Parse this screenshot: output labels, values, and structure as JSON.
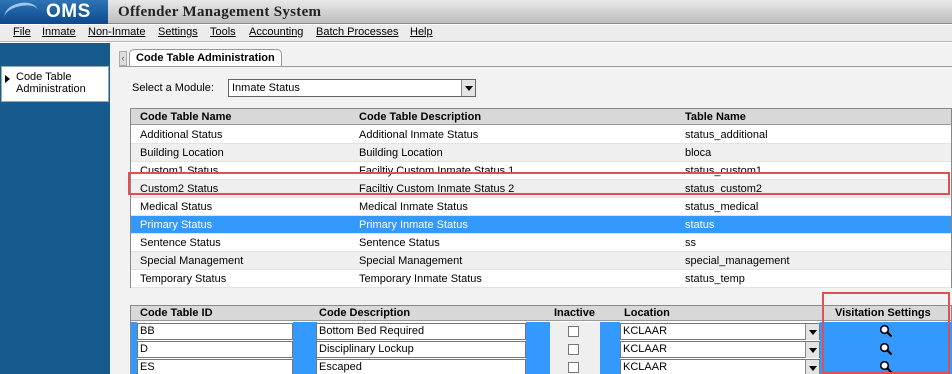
{
  "app": {
    "logo": "OMS",
    "title": "Offender Management System"
  },
  "menu": [
    "File",
    "Inmate",
    "Non-Inmate",
    "Settings",
    "Tools",
    "Accounting",
    "Batch Processes",
    "Help"
  ],
  "sidebar": {
    "items": [
      {
        "label": "Code Table Administration",
        "arrow_icon": "triangle-right-icon"
      }
    ]
  },
  "tab": {
    "label": "Code Table Administration"
  },
  "module": {
    "label": "Select a Module:",
    "value": "Inmate Status"
  },
  "code_tables": {
    "headers": [
      "Code Table Name",
      "Code Table Description",
      "Table Name"
    ],
    "rows": [
      [
        "Additional Status",
        "Additional Inmate Status",
        "status_additional"
      ],
      [
        "Building Location",
        "Building Location",
        "bloca"
      ],
      [
        "Custom1 Status",
        "Faciltiy Custom Inmate Status 1",
        "status_custom1"
      ],
      [
        "Custom2 Status",
        "Faciltiy Custom Inmate Status 2",
        "status_custom2"
      ],
      [
        "Medical Status",
        "Medical Inmate Status",
        "status_medical"
      ],
      [
        "Primary Status",
        "Primary Inmate Status",
        "status"
      ],
      [
        "Sentence Status",
        "Sentence Status",
        "ss"
      ],
      [
        "Special Management",
        "Special Management",
        "special_management"
      ],
      [
        "Temporary Status",
        "Temporary Inmate Status",
        "status_temp"
      ]
    ],
    "selected_index": 5,
    "selected_color": "#3399ff"
  },
  "codes": {
    "headers": [
      "Code Table ID",
      "Code Description",
      "Inactive",
      "Location",
      "Visitation Settings"
    ],
    "rows": [
      {
        "id": "BB",
        "description": "Bottom Bed Required",
        "location": "KCLAAR",
        "inactive": false,
        "visitation_icon": "magnifier-icon"
      },
      {
        "id": "D",
        "description": "Disciplinary Lockup",
        "location": "KCLAAR",
        "inactive": false,
        "visitation_icon": "magnifier-icon"
      },
      {
        "id": "ES",
        "description": "Escaped",
        "location": "KCLAAR",
        "inactive": false,
        "visitation_icon": "magnifier-icon"
      }
    ]
  },
  "colors": {
    "highlight_outline": "#e05050",
    "sidebar_bg": "#165a8e",
    "selection": "#3399ff"
  }
}
